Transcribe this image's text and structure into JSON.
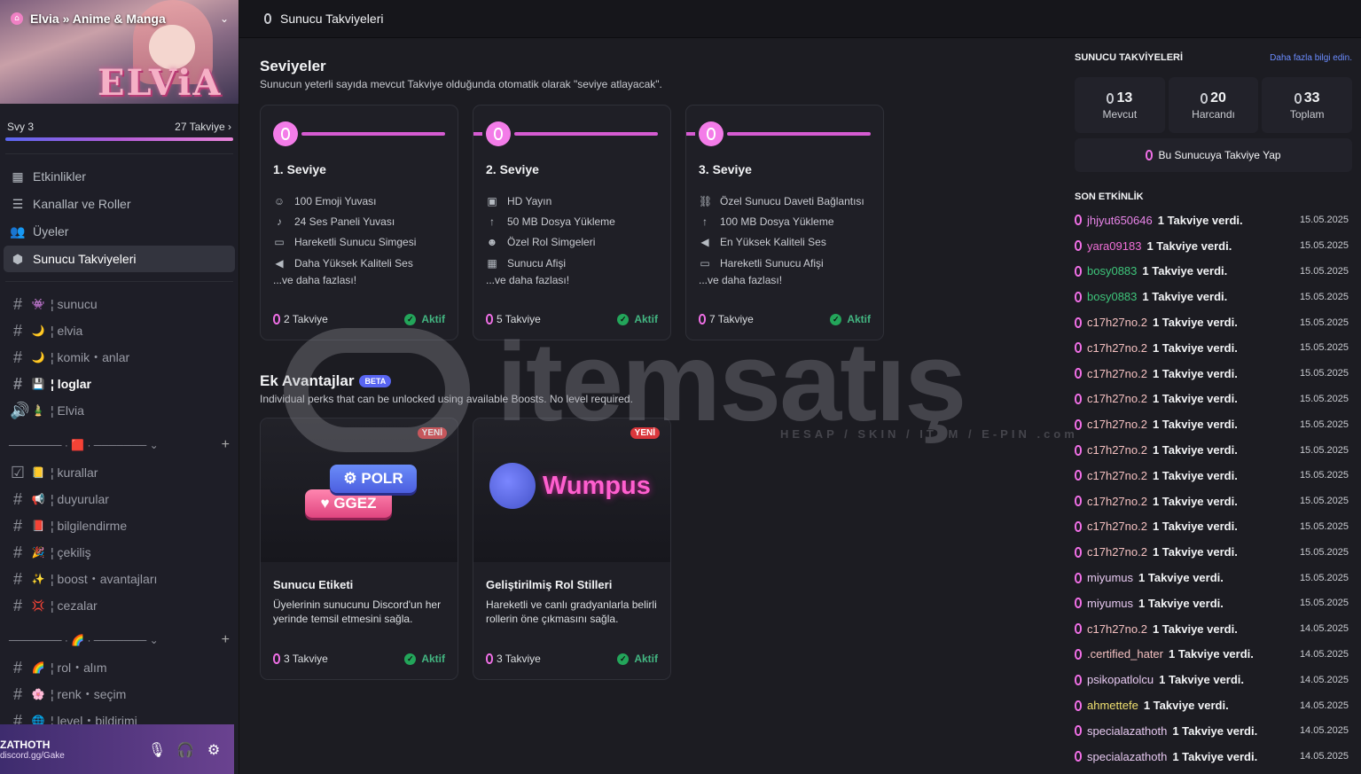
{
  "sidebar": {
    "server_name": "Elvia » Anime & Manga",
    "banner_logo": "ELViA",
    "level": "Svy 3",
    "boost_count": "27 Takviye",
    "nav": [
      "Etkinlikler",
      "Kanallar ve Roller",
      "Üyeler",
      "Sunucu Takviyeleri"
    ],
    "categories": [
      "─────── · 🟥 · ─────── ⌄",
      "─────── · 🌈 · ─────── ⌄"
    ],
    "channels": [
      {
        "emoji": "👾",
        "name": "¦ sunucu"
      },
      {
        "emoji": "🌙",
        "name": "¦ elvia"
      },
      {
        "emoji": "🌙",
        "name": "¦ komik・anlar"
      },
      {
        "emoji": "💾",
        "name": "¦ loglar"
      },
      {
        "emoji": "🎍",
        "name": "¦ Elvia"
      },
      {
        "emoji": "📒",
        "name": "¦ kurallar"
      },
      {
        "emoji": "📢",
        "name": "¦ duyurular"
      },
      {
        "emoji": "📕",
        "name": "¦ bilgilendirme"
      },
      {
        "emoji": "🎉",
        "name": "¦ çekiliş"
      },
      {
        "emoji": "✨",
        "name": "¦ boost・avantajları"
      },
      {
        "emoji": "💢",
        "name": "¦ cezalar"
      },
      {
        "emoji": "🌈",
        "name": "¦ rol・alım"
      },
      {
        "emoji": "🌸",
        "name": "¦ renk・seçim"
      },
      {
        "emoji": "🌐",
        "name": "¦ level・bildirimi"
      }
    ]
  },
  "user": {
    "name": "ZATHOTH",
    "status": "discord.gg/Gake"
  },
  "topbar": {
    "title": "Sunucu Takviyeleri"
  },
  "main": {
    "levels_title": "Seviyeler",
    "levels_subtitle": "Sunucun yeterli sayıda mevcut Takviye olduğunda otomatik olarak \"seviye atlayacak\".",
    "more": "...ve daha fazlası!",
    "active": "Aktif",
    "new": "YENİ",
    "beta": "BETA",
    "levels": [
      {
        "title": "1. Seviye",
        "cost": "2 Takviye",
        "perks": [
          "100 Emoji Yuvası",
          "24 Ses Paneli Yuvası",
          "Hareketli Sunucu Simgesi",
          "Daha Yüksek Kaliteli Ses"
        ]
      },
      {
        "title": "2. Seviye",
        "cost": "5 Takviye",
        "perks": [
          "HD Yayın",
          "50 MB Dosya Yükleme",
          "Özel Rol Simgeleri",
          "Sunucu Afişi"
        ]
      },
      {
        "title": "3. Seviye",
        "cost": "7 Takviye",
        "perks": [
          "Özel Sunucu Daveti Bağlantısı",
          "100 MB Dosya Yükleme",
          "En Yüksek Kaliteli Ses",
          "Hareketli Sunucu Afişi"
        ]
      }
    ],
    "extra_title": "Ek Avantajlar",
    "extra_subtitle": "Individual perks that can be unlocked using available Boosts. No level required.",
    "perks": [
      {
        "title": "Sunucu Etiketi",
        "desc": "Üyelerinin sunucunu Discord'un her yerinde temsil etmesini sağla.",
        "cost": "3 Takviye",
        "tag1": "⚙ POLR",
        "tag2": "♥ GGEZ"
      },
      {
        "title": "Geliştirilmiş Rol Stilleri",
        "desc": "Hareketli ve canlı gradyanlarla belirli rollerin öne çıkmasını sağla.",
        "cost": "3 Takviye",
        "art_text": "Wumpus"
      }
    ]
  },
  "right": {
    "title": "SUNUCU TAKVİYELERİ",
    "link": "Daha fazla bilgi edin.",
    "stats": [
      {
        "n": "13",
        "label": "Mevcut"
      },
      {
        "n": "20",
        "label": "Harcandı"
      },
      {
        "n": "33",
        "label": "Toplam"
      }
    ],
    "boost_button": "Bu Sunucuya Takviye Yap",
    "recent_title": "SON ETKİNLİK",
    "activity": [
      {
        "user": "jhjyut650646",
        "color": "#e884e8",
        "text": "1 Takviye verdi.",
        "date": "15.05.2025"
      },
      {
        "user": "yara09183",
        "color": "#f06fd8",
        "text": "1 Takviye verdi.",
        "date": "15.05.2025"
      },
      {
        "user": "bosy0883",
        "color": "#3ec47a",
        "text": "1 Takviye verdi.",
        "date": "15.05.2025"
      },
      {
        "user": "bosy0883",
        "color": "#3ec47a",
        "text": "1 Takviye verdi.",
        "date": "15.05.2025"
      },
      {
        "user": "c17h27no.2",
        "color": "#f4c0c0",
        "text": "1 Takviye verdi.",
        "date": "15.05.2025"
      },
      {
        "user": "c17h27no.2",
        "color": "#f4c0c0",
        "text": "1 Takviye verdi.",
        "date": "15.05.2025"
      },
      {
        "user": "c17h27no.2",
        "color": "#f4c0c0",
        "text": "1 Takviye verdi.",
        "date": "15.05.2025"
      },
      {
        "user": "c17h27no.2",
        "color": "#f4c0c0",
        "text": "1 Takviye verdi.",
        "date": "15.05.2025"
      },
      {
        "user": "c17h27no.2",
        "color": "#f4c0c0",
        "text": "1 Takviye verdi.",
        "date": "15.05.2025"
      },
      {
        "user": "c17h27no.2",
        "color": "#f4c0c0",
        "text": "1 Takviye verdi.",
        "date": "15.05.2025"
      },
      {
        "user": "c17h27no.2",
        "color": "#f4c0c0",
        "text": "1 Takviye verdi.",
        "date": "15.05.2025"
      },
      {
        "user": "c17h27no.2",
        "color": "#f4c0c0",
        "text": "1 Takviye verdi.",
        "date": "15.05.2025"
      },
      {
        "user": "c17h27no.2",
        "color": "#f4c0c0",
        "text": "1 Takviye verdi.",
        "date": "15.05.2025"
      },
      {
        "user": "c17h27no.2",
        "color": "#f4c0c0",
        "text": "1 Takviye verdi.",
        "date": "15.05.2025"
      },
      {
        "user": "miyumus",
        "color": "#e6c8f0",
        "text": "1 Takviye verdi.",
        "date": "15.05.2025"
      },
      {
        "user": "miyumus",
        "color": "#e6c8f0",
        "text": "1 Takviye verdi.",
        "date": "15.05.2025"
      },
      {
        "user": "c17h27no.2",
        "color": "#f4c0c0",
        "text": "1 Takviye verdi.",
        "date": "14.05.2025"
      },
      {
        "user": ".certified_hater",
        "color": "#f4c0c0",
        "text": "1 Takviye verdi.",
        "date": "14.05.2025"
      },
      {
        "user": "psikopatlolcu",
        "color": "#e6c8f0",
        "text": "1 Takviye verdi.",
        "date": "14.05.2025"
      },
      {
        "user": "ahmettefe",
        "color": "#f0e070",
        "text": "1 Takviye verdi.",
        "date": "14.05.2025"
      },
      {
        "user": "specialazathoth",
        "color": "#e6c8f0",
        "text": "1 Takviye verdi.",
        "date": "14.05.2025"
      },
      {
        "user": "specialazathoth",
        "color": "#e6c8f0",
        "text": "1 Takviye verdi.",
        "date": "14.05.2025"
      }
    ]
  },
  "watermark": {
    "text": "itemsatış",
    "tagline": "HESAP / SKIN / ITEM / E-PIN .com"
  }
}
